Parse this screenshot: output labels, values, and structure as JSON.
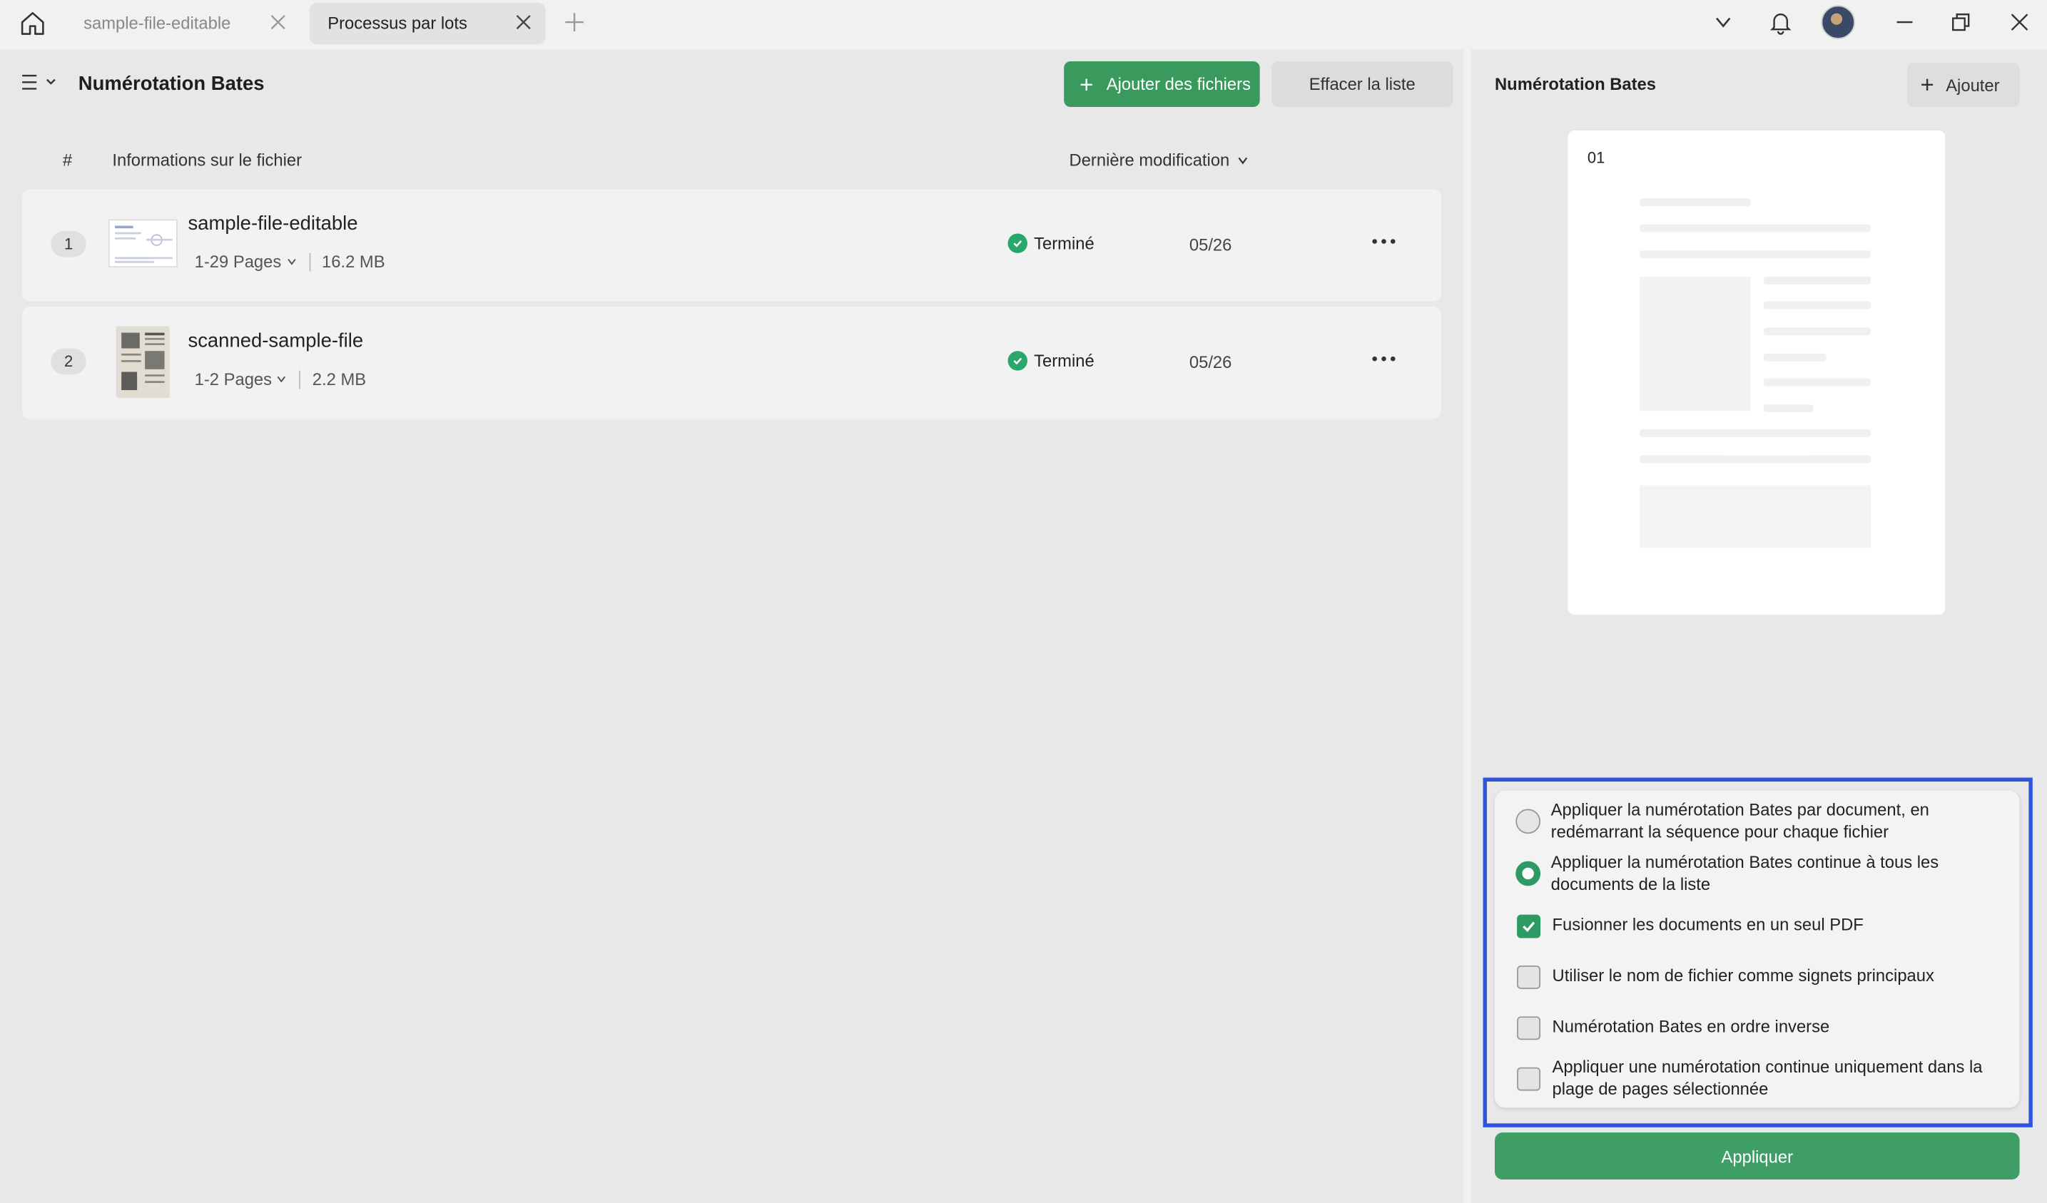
{
  "tabs": [
    {
      "label": "sample-file-editable"
    },
    {
      "label": "Processus par lots"
    }
  ],
  "header": {
    "title": "Numérotation Bates",
    "add_files_label": "Ajouter des fichiers",
    "clear_list_label": "Effacer la liste"
  },
  "table": {
    "columns": {
      "index": "#",
      "info": "Informations sur le fichier",
      "modified": "Dernière modification"
    },
    "rows": [
      {
        "num": "1",
        "name": "sample-file-editable",
        "pages": "1-29 Pages",
        "size": "16.2 MB",
        "status": "Terminé",
        "date": "05/26"
      },
      {
        "num": "2",
        "name": "scanned-sample-file",
        "pages": "1-2 Pages",
        "size": "2.2 MB",
        "status": "Terminé",
        "date": "05/26"
      }
    ]
  },
  "right_panel": {
    "title": "Numérotation Bates",
    "add_label": "Ajouter",
    "preview_number": "01",
    "options": [
      {
        "type": "radio",
        "checked": false,
        "label": "Appliquer la numérotation Bates par document, en redémarrant la séquence pour chaque fichier"
      },
      {
        "type": "radio",
        "checked": true,
        "label": "Appliquer la numérotation Bates continue à tous les documents de la liste"
      },
      {
        "type": "checkbox",
        "checked": true,
        "label": "Fusionner les documents en un seul PDF"
      },
      {
        "type": "checkbox",
        "checked": false,
        "label": "Utiliser le nom de fichier comme signets principaux"
      },
      {
        "type": "checkbox",
        "checked": false,
        "label": "Numérotation Bates en ordre inverse"
      },
      {
        "type": "checkbox",
        "checked": false,
        "label": "Appliquer une numérotation continue uniquement dans la plage de pages sélectionnée"
      }
    ],
    "apply_label": "Appliquer"
  },
  "colors": {
    "accent": "#3a9a5e",
    "highlight_frame": "#2f55e0"
  }
}
